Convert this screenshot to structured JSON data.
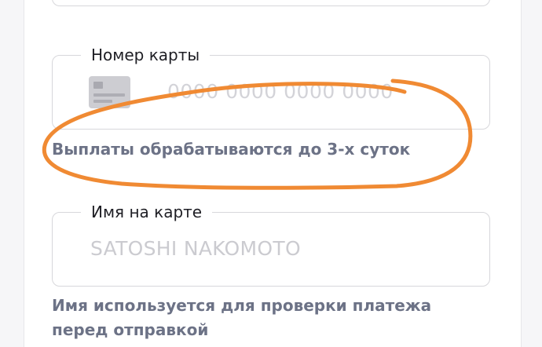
{
  "card_field": {
    "label": "Номер карты",
    "placeholder": "0000 0000 0000 0000",
    "hint": "Выплаты обрабатываются до 3-х суток"
  },
  "name_field": {
    "label": "Имя на карте",
    "placeholder": "SATOSHI NAKOMOTO",
    "hint": "Имя используется для проверки платежа перед отправкой"
  },
  "icons": {
    "card_field_icon": "credit-card-icon"
  },
  "colors": {
    "annotation_stroke": "#f08a33",
    "hint_text": "#6c7286",
    "field_border": "#d7d7db",
    "placeholder_text": "#d3d3d8"
  }
}
